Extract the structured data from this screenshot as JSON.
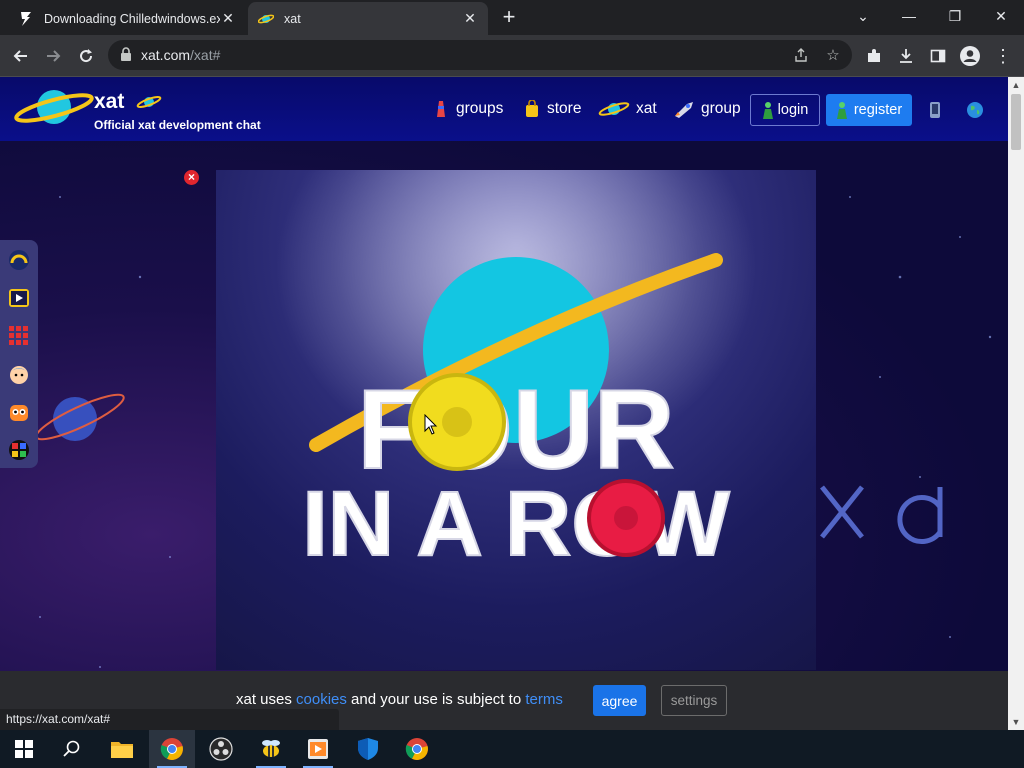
{
  "browser": {
    "tabs": [
      {
        "title": "Downloading Chilledwindows.ex",
        "close": "✕"
      },
      {
        "title": "xat",
        "close": "✕"
      }
    ],
    "new_tab": "+",
    "window_controls": {
      "minimize": "—",
      "restore": "❐",
      "close": "✕",
      "tab_search": "⌄"
    },
    "url_host": "xat.com",
    "url_path": "/xat#",
    "status_url": "https://xat.com/xat#"
  },
  "site": {
    "brand": "xat",
    "tagline": "Official xat development chat",
    "nav": [
      {
        "label": "groups",
        "icon": "groups-icon"
      },
      {
        "label": "store",
        "icon": "store-bag-icon"
      },
      {
        "label": "xat",
        "icon": "xat-planet-icon"
      },
      {
        "label": "group",
        "icon": "group-rocket-icon"
      }
    ],
    "login": "login",
    "register": "register",
    "game_close": "×",
    "game_title_line1": "FOUR",
    "game_title_line2": "IN A ROW",
    "side_apps": [
      "rainbow-app-icon",
      "video-app-icon",
      "grid-app-icon",
      "avatar-app-icon",
      "robot-app-icon",
      "color-wheel-app-icon"
    ]
  },
  "cookie": {
    "text_before": "xat uses ",
    "cookies_link": "cookies",
    "text_middle": " and your use is subject to ",
    "terms_link": "terms",
    "agree": "agree",
    "settings": "settings"
  },
  "taskbar": [
    "start-icon",
    "search-icon",
    "file-explorer-icon",
    "chrome-icon",
    "obs-icon",
    "bee-app-icon",
    "media-app-icon",
    "defender-icon",
    "chrome-icon"
  ],
  "colors": {
    "header": "#0a0f8a",
    "register": "#1e7cf0",
    "agree": "#1a73e8",
    "link": "#3f8ef7"
  }
}
